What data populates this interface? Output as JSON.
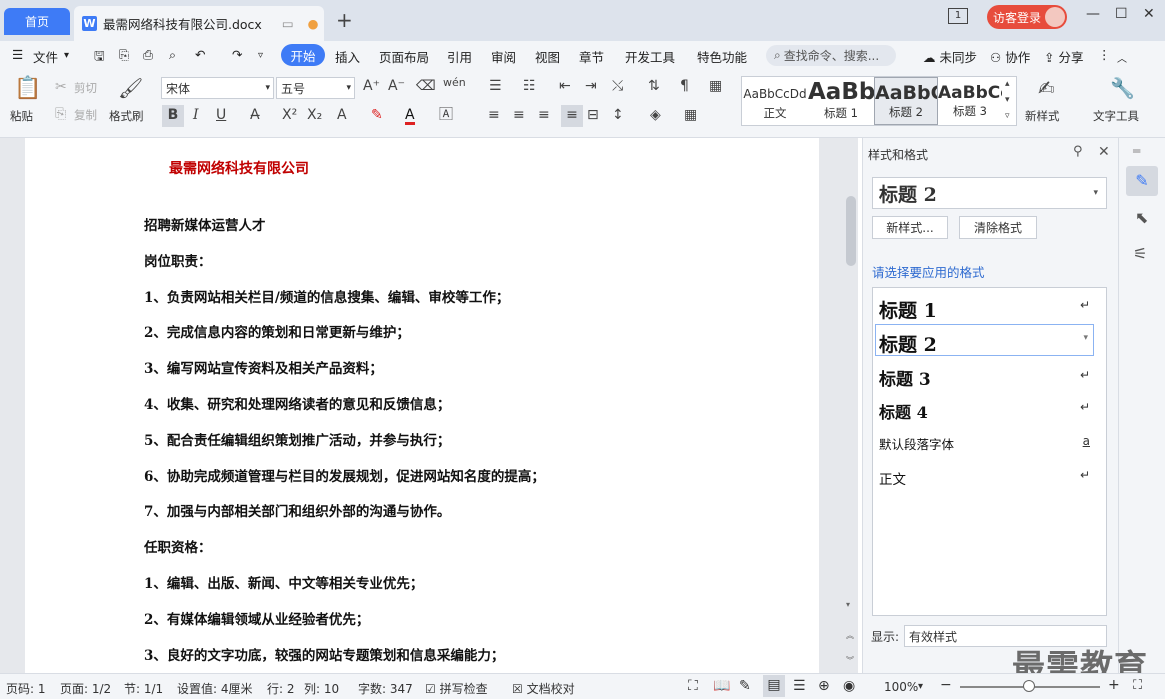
{
  "titlebar": {
    "home_tab": "首页",
    "doc_tab": "最需网络科技有限公司.docx",
    "login": "访客登录",
    "page_indicator": "1"
  },
  "menubar": {
    "file": "文件",
    "tabs": [
      "开始",
      "插入",
      "页面布局",
      "引用",
      "审阅",
      "视图",
      "章节",
      "开发工具",
      "特色功能"
    ],
    "search": "查找命令、搜索...",
    "sync": "未同步",
    "collab": "协作",
    "share": "分享"
  },
  "toolbar": {
    "paste": "粘贴",
    "cut": "剪切",
    "copy": "复制",
    "format_painter": "格式刷",
    "font_name": "宋体",
    "font_size": "五号",
    "styles": [
      {
        "sample": "AaBbCcDd",
        "label": "正文"
      },
      {
        "sample": "AaBb",
        "label": "标题 1"
      },
      {
        "sample": "AaBbC",
        "label": "标题 2"
      },
      {
        "sample": "AaBbCc",
        "label": "标题 3"
      }
    ],
    "new_style": "新样式",
    "text_tools": "文字工具"
  },
  "document": {
    "company": "最需网络科技有限公司",
    "lines": [
      "招聘新媒体运营人才",
      "岗位职责：",
      "1、负责网站相关栏目/频道的信息搜集、编辑、审校等工作；",
      "2、完成信息内容的策划和日常更新与维护；",
      "3、编写网站宣传资料及相关产品资料；",
      "4、收集、研究和处理网络读者的意见和反馈信息；",
      "5、配合责任编辑组织策划推广活动，并参与执行；",
      "6、协助完成频道管理与栏目的发展规划，促进网站知名度的提高；",
      "7、加强与内部相关部门和组织外部的沟通与协作。",
      "任职资格：",
      "1、编辑、出版、新闻、中文等相关专业优先；",
      "2、有媒体编辑领域从业经验者优先；",
      "3、良好的文字功底，较强的网站专题策划和信息采编能力；"
    ]
  },
  "pane": {
    "title": "样式和格式",
    "current_style": "标题  2",
    "new_style_btn": "新样式...",
    "clear_btn": "清除格式",
    "prompt": "请选择要应用的格式",
    "styles": [
      "标题  1",
      "标题  2",
      "标题  3",
      "标题  4",
      "默认段落字体",
      "正文"
    ],
    "show_label": "显示:",
    "show_value": "有效样式"
  },
  "status": {
    "page_num": "页码: 1",
    "pages": "页面: 1/2",
    "section": "节: 1/1",
    "setting": "设置值: 4厘米",
    "row": "行: 2",
    "col": "列: 10",
    "words": "字数: 347",
    "spell": "拼写检查",
    "proof": "文档校对",
    "zoom": "100%"
  },
  "watermark": "最需教育"
}
